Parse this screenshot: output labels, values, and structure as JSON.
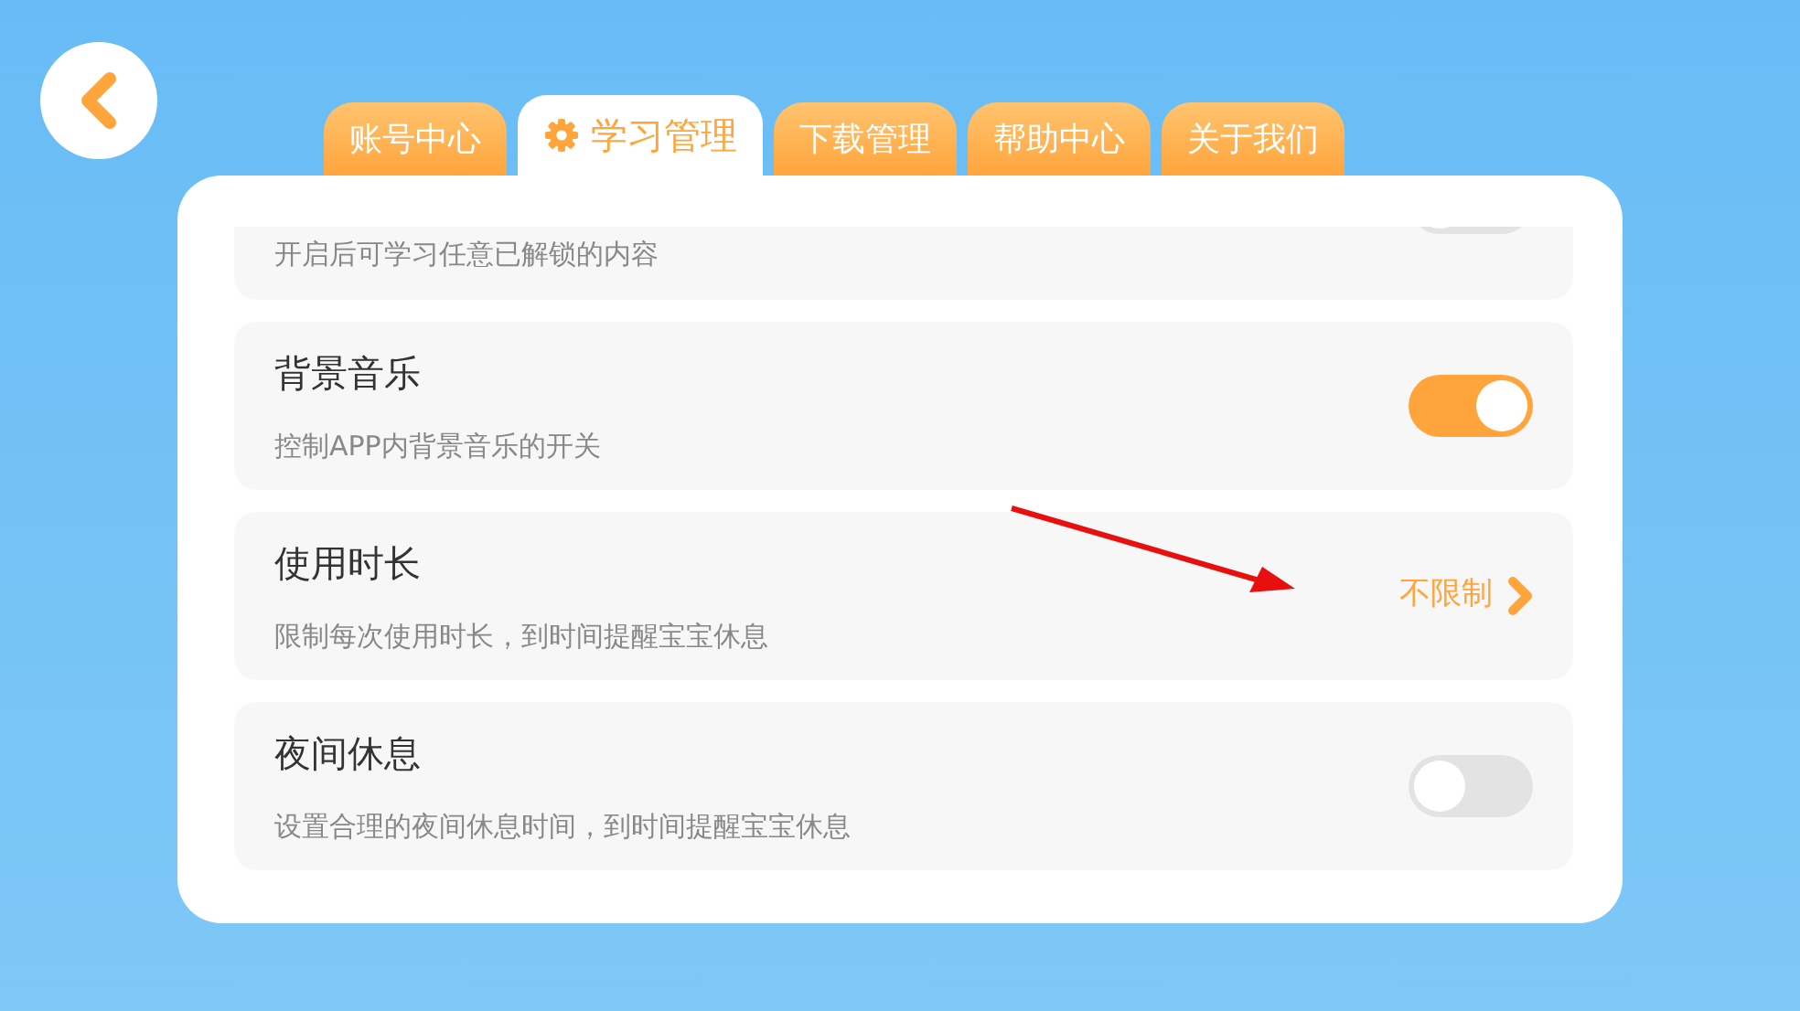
{
  "tabs": [
    {
      "label": "账号中心",
      "selected": false
    },
    {
      "label": "学习管理",
      "selected": true
    },
    {
      "label": "下载管理",
      "selected": false
    },
    {
      "label": "帮助中心",
      "selected": false
    },
    {
      "label": "关于我们",
      "selected": false
    }
  ],
  "settings": [
    {
      "kind": "toggle",
      "description": "开启后可学习任意已解锁的内容",
      "on": false
    },
    {
      "kind": "toggle",
      "title": "背景音乐",
      "description": "控制APP内背景音乐的开关",
      "on": true
    },
    {
      "kind": "link",
      "title": "使用时长",
      "description": "限制每次使用时长，到时间提醒宝宝休息",
      "value": "不限制"
    },
    {
      "kind": "toggle",
      "title": "夜间休息",
      "description": "设置合理的夜间休息时间，到时间提醒宝宝休息",
      "on": false
    }
  ]
}
